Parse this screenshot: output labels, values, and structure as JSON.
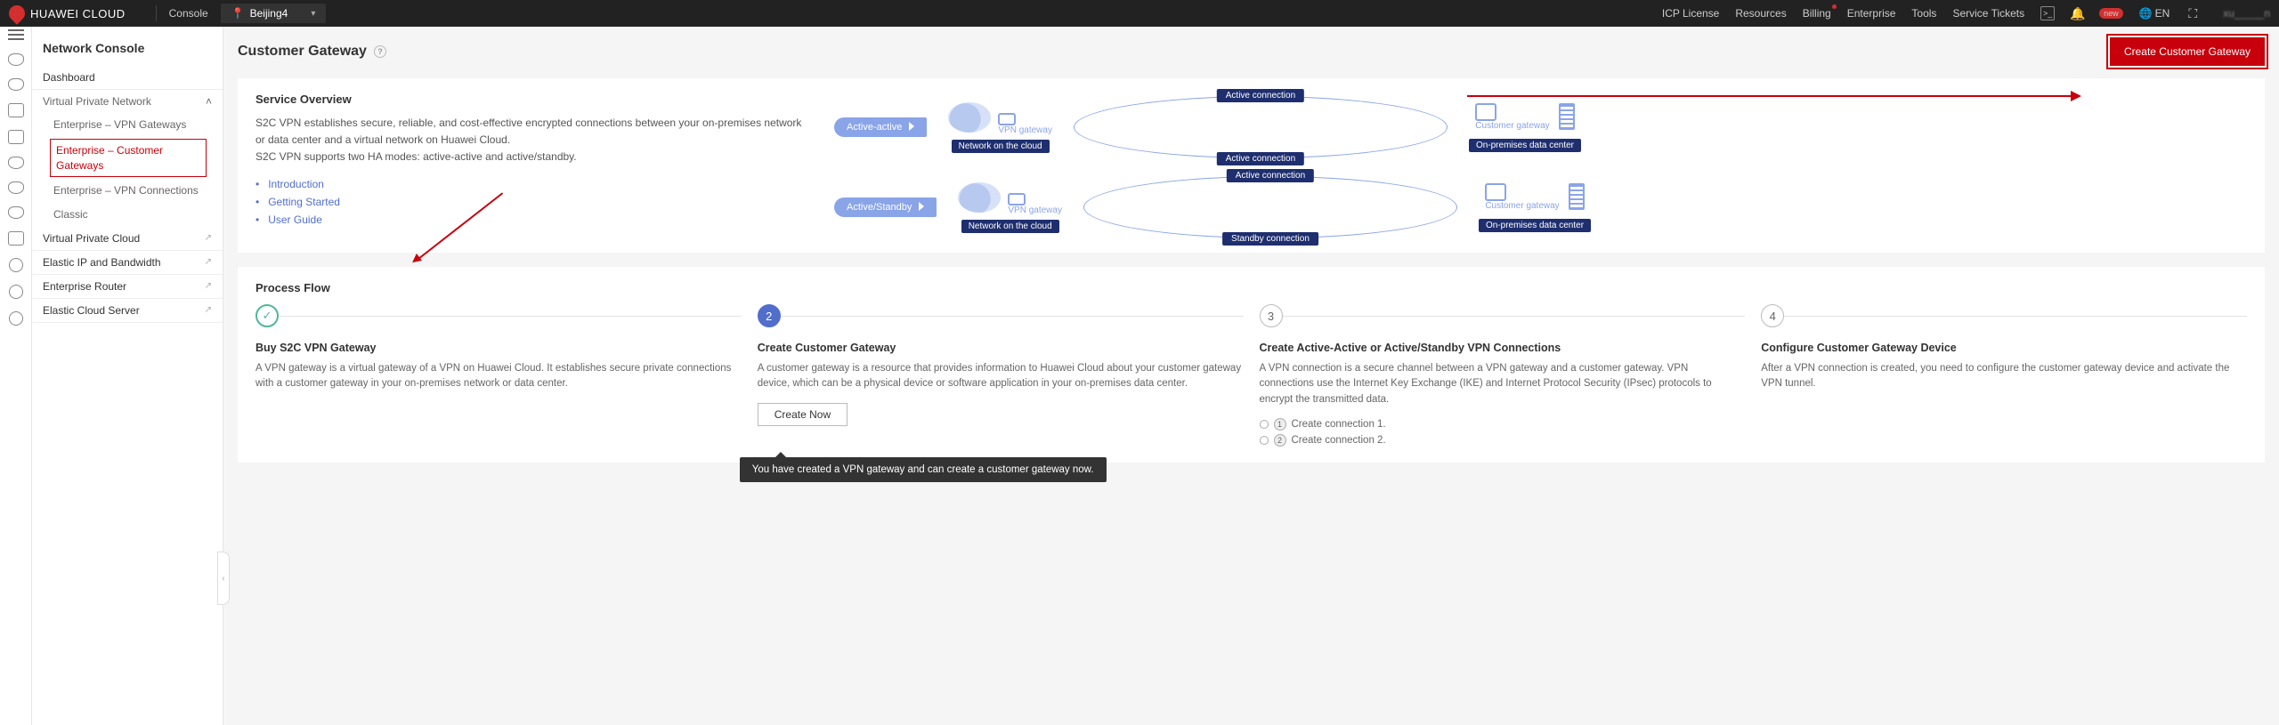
{
  "topbar": {
    "brand": "HUAWEI CLOUD",
    "console": "Console",
    "region": "Beijing4",
    "links": {
      "icp": "ICP License",
      "resources": "Resources",
      "billing": "Billing",
      "enterprise": "Enterprise",
      "tools": "Tools",
      "tickets": "Service Tickets"
    },
    "badge": "new",
    "lang": "EN",
    "user": "xu_____n"
  },
  "sidebar": {
    "title": "Network Console",
    "items": {
      "dashboard": "Dashboard",
      "vpn": "Virtual Private Network",
      "vpn_gateways": "Enterprise – VPN Gateways",
      "customer_gateways": "Enterprise – Customer Gateways",
      "vpn_connections": "Enterprise – VPN Connections",
      "classic": "Classic",
      "vpc": "Virtual Private Cloud",
      "eip": "Elastic IP and Bandwidth",
      "er": "Enterprise Router",
      "ecs": "Elastic Cloud Server"
    }
  },
  "page": {
    "title": "Customer Gateway",
    "create_btn": "Create Customer Gateway"
  },
  "overview": {
    "heading": "Service Overview",
    "p1": "S2C VPN establishes secure, reliable, and cost-effective encrypted connections between your on-premises network or data center and a virtual network on Huawei Cloud.",
    "p2": "S2C VPN supports two HA modes: active-active and active/standby.",
    "links": {
      "intro": "Introduction",
      "start": "Getting Started",
      "guide": "User Guide"
    },
    "mode1": "Active-active",
    "mode2": "Active/Standby",
    "cloud_label": "Network on the cloud",
    "vpn_label": "VPN gateway",
    "conn_active": "Active connection",
    "conn_standby": "Standby connection",
    "cust_gw": "Customer gateway",
    "onprem": "On-premises data center"
  },
  "process": {
    "heading": "Process Flow",
    "steps": [
      {
        "num": "✓",
        "state": "done",
        "title": "Buy S2C VPN Gateway",
        "desc": "A VPN gateway is a virtual gateway of a VPN on Huawei Cloud. It establishes secure private connections with a customer gateway in your on-premises network or data center."
      },
      {
        "num": "2",
        "state": "active",
        "title": "Create Customer Gateway",
        "desc": "A customer gateway is a resource that provides information to Huawei Cloud about your customer gateway device, which can be a physical device or software application in your on-premises data center.",
        "btn": "Create Now",
        "tooltip": "You have created a VPN gateway and can create a customer gateway now."
      },
      {
        "num": "3",
        "state": "pending",
        "title": "Create Active-Active or Active/Standby VPN Connections",
        "desc": "A VPN connection is a secure channel between a VPN gateway and a customer gateway. VPN connections use the Internet Key Exchange (IKE) and Internet Protocol Security (IPsec) protocols to encrypt the transmitted data.",
        "sub": [
          "Create connection 1.",
          "Create connection 2."
        ]
      },
      {
        "num": "4",
        "state": "pending",
        "title": "Configure Customer Gateway Device",
        "desc": "After a VPN connection is created, you need to configure the customer gateway device and activate the VPN tunnel."
      }
    ]
  }
}
